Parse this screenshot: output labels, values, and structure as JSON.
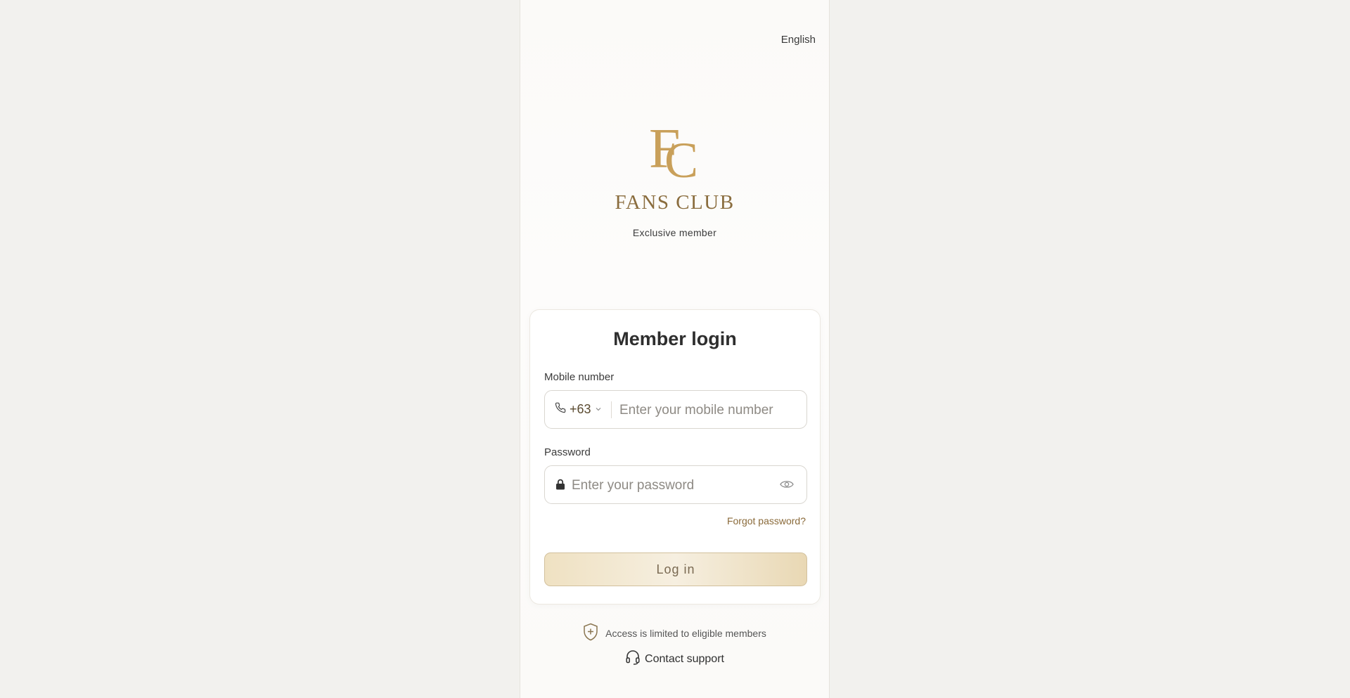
{
  "header": {
    "language": "English"
  },
  "brand": {
    "monogram": "FC",
    "name": "FANS CLUB",
    "tagline": "Exclusive member"
  },
  "login": {
    "title": "Member login",
    "mobile_label": "Mobile number",
    "country_code": "+63",
    "mobile_placeholder": "Enter your mobile number",
    "password_label": "Password",
    "password_placeholder": "Enter your password",
    "forgot_label": "Forgot password?",
    "submit_label": "Log in"
  },
  "footer": {
    "access_note": "Access is limited to eligible members",
    "support_label": "Contact support"
  },
  "colors": {
    "accent": "#c9a05a",
    "brand_text": "#8a6d3e",
    "button_bg": "#efe1c2"
  }
}
